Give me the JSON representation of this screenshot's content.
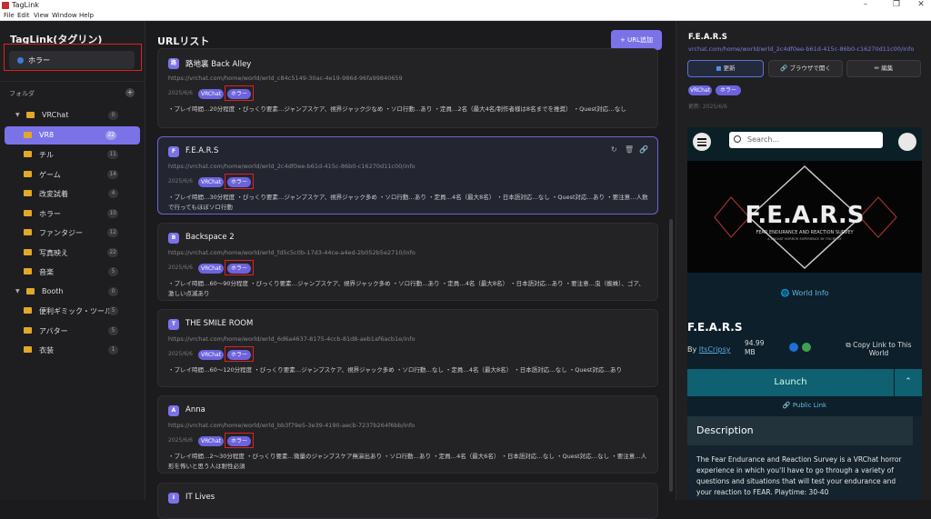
{
  "window": {
    "title": "TagLink",
    "menus": [
      "File",
      "Edit",
      "View",
      "Window",
      "Help"
    ]
  },
  "sidebar": {
    "brand": "TagLink(タグリン)",
    "search_value": "ホラー",
    "folders_label": "フォルダ",
    "add": "+",
    "items": [
      {
        "label": "VRChat",
        "count": "0",
        "level": 0,
        "caret": "▼"
      },
      {
        "label": "VR8",
        "count": "22",
        "level": 1,
        "selected": true
      },
      {
        "label": "チル",
        "count": "11",
        "level": 1
      },
      {
        "label": "ゲーム",
        "count": "14",
        "level": 1
      },
      {
        "label": "改変試着",
        "count": "4",
        "level": 1
      },
      {
        "label": "ホラー",
        "count": "10",
        "level": 1
      },
      {
        "label": "ファンタジー",
        "count": "12",
        "level": 1
      },
      {
        "label": "写真映え",
        "count": "22",
        "level": 1
      },
      {
        "label": "音楽",
        "count": "5",
        "level": 1
      },
      {
        "label": "Booth",
        "count": "0",
        "level": 0,
        "caret": "▼"
      },
      {
        "label": "便利ギミック・ツール",
        "count": "5",
        "level": 1
      },
      {
        "label": "アバター",
        "count": "5",
        "level": 1
      },
      {
        "label": "衣装",
        "count": "1",
        "level": 1
      }
    ]
  },
  "main": {
    "title": "URLリスト",
    "add_button": "+ URL追加",
    "cards": [
      {
        "icon": "路",
        "title": "路地裏 Back Alley",
        "url": "https://vrchat.com/home/world/wrld_c84c5149-30ac-4e19-986d-96fa99840659",
        "date": "2025/6/6",
        "tags": [
          "VRChat",
          "ホラー"
        ],
        "desc": "・プレイ時間…20分程度 ・びっくり要素…ジャンプスケア、視界ジャック少なめ ・ソロ行動…あり ・定員…2名（最大4名/制作者様は8名までを推奨） ・Quest対応…なし"
      },
      {
        "icon": "F",
        "title": "F.E.A.R.S",
        "url": "https://vrchat.com/home/world/wrld_2c4df0ee-b61d-415c-86b0-c16270d11c00/info",
        "date": "2025/6/6",
        "tags": [
          "VRChat",
          "ホラー"
        ],
        "desc": "・プレイ時間…30分程度 ・びっくり要素…ジャンプスケア、視界ジャック多め ・ソロ行動…あり ・定員…4名（最大8名） ・日本語対応…なし ・Quest対応…あり ・要注意…人数で行ってもほぼソロ行動"
      },
      {
        "icon": "B",
        "title": "Backspace 2",
        "url": "https://vrchat.com/home/world/wrld_fd5c5c0b-17d3-44ce-a4ed-2b052b5e2710/info",
        "date": "2025/6/6",
        "tags": [
          "VRChat",
          "ホラー"
        ],
        "desc": "・プレイ時間…60〜90分程度 ・びっくり要素…ジャンプスケア、視界ジャック多め ・ソロ行動…あり ・定員…4名（最大8名） ・日本語対応…あり ・要注意…虫（蜘蛛）、ゴア、激しい点滅あり"
      },
      {
        "icon": "T",
        "title": "THE SMILE ROOM",
        "url": "https://vrchat.com/home/world/wrld_6d6a4637-8175-4ccb-81d8-aeb1af6acb1e/info",
        "date": "2025/6/6",
        "tags": [
          "VRChat",
          "ホラー"
        ],
        "desc": "・プレイ時間…60〜120分程度 ・びっくり要素…ジャンプスケア、視界ジャック多め ・ソロ行動…なし ・定員…4名（最大8名） ・日本語対応…なし ・Quest対応…あり"
      },
      {
        "icon": "A",
        "title": "Anna",
        "url": "https://vrchat.com/home/world/wrld_bb3f79e5-3e39-4190-aecb-7237b264f6bb/info",
        "date": "2025/6/6",
        "tags": [
          "VRChat",
          "ホラー"
        ],
        "desc": "・プレイ時間…2〜30分程度 ・びっくり要素…微量のジャンプスケア無演出あり ・ソロ行動…あり ・定員…4名（最大6名） ・日本語対応…なし ・Quest対応…なし ・要注意…人形を怖いと思う人は耐性必須"
      },
      {
        "icon": "I",
        "title": "IT Lives",
        "url": "",
        "date": "",
        "tags": [],
        "desc": ""
      }
    ]
  },
  "detail": {
    "title": "F.E.A.R.S",
    "url": "vrchat.com/home/world/wrld_2c4df0ee-b61d-415c-86b0-c16270d11c00/info",
    "buttons": {
      "update": "更新",
      "open": "ブラウザで開く",
      "edit": "編集"
    },
    "tags": [
      "VRChat",
      "ホラー"
    ],
    "updated": "更新: 2025/6/6",
    "embed": {
      "search_placeholder": "Search...",
      "world_info": "World Info",
      "title": "F.E.A.R.S",
      "by": "By",
      "author": "ItsCripsy",
      "size": "94.99 MB",
      "copy_link": "Copy Link to This World",
      "launch": "Launch",
      "public_link": "Public Link",
      "description_header": "Description",
      "description": "The Fear Endurance and Reaction Survey is a VRChat horror experience in which you'll have to go through a variety of questions and situations that will test your endurance and your reaction to FEAR. Playtime: 30-40",
      "banner_title": "F.E.A.R.S",
      "banner_sub": "FEAR ENDURANCE AND REACTION SURVEY",
      "banner_sub2": "A VRCHAT HORROR EXPERIENCE BY ITSCRIPSY"
    }
  },
  "colors": {
    "accent": "#7c72e8",
    "highlight": "#e02020",
    "folder": "#e2a82a",
    "launch": "#0f6070"
  }
}
